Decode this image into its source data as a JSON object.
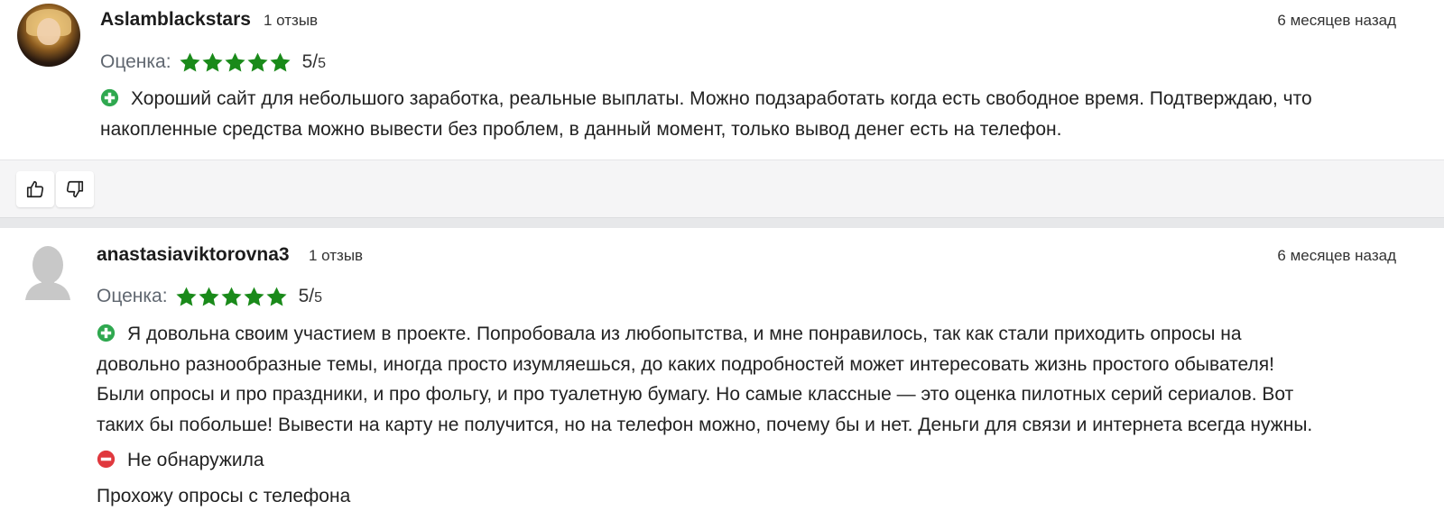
{
  "reviews": [
    {
      "username": "Aslamblackstars",
      "review_count": "1 отзыв",
      "date": "6 месяцев назад",
      "rating_label": "Оценка:",
      "rating_value": 5,
      "rating_max": 5,
      "score_num": "5/",
      "score_den": "5",
      "pros_icon": "plus-circle-icon",
      "pros_line1": "Хороший сайт для небольшого заработка, реальные выплаты. Можно подзаработать когда есть свободное время. Подтверждаю, что",
      "pros_line2": "накопленные средства можно вывести без проблем, в данный момент, только вывод денег есть на телефон."
    },
    {
      "username": "anastasiaviktorovna3",
      "review_count": "1 отзыв",
      "date": "6 месяцев назад",
      "rating_label": "Оценка:",
      "rating_value": 5,
      "rating_max": 5,
      "score_num": "5/",
      "score_den": "5",
      "pros_icon": "plus-circle-icon",
      "pros_line1": "Я довольна своим участием в проекте. Попробовала из любопытства, и мне понравилось, так как стали приходить опросы на",
      "pros_line2": "довольно разнообразные темы, иногда просто изумляешься, до каких подробностей может интересовать жизнь простого обывателя!",
      "pros_line3": "Были опросы и про праздники, и про фольгу, и про туалетную бумагу. Но самые классные — это оценка пилотных серий сериалов. Вот",
      "pros_line4": "таких бы побольше! Вывести на карту не получится, но на телефон можно, почему бы и нет. Деньги для связи и интернета всегда нужны.",
      "cons_icon": "minus-circle-icon",
      "cons": "Не обнаружила",
      "comment": "Прохожу опросы с телефона"
    }
  ],
  "votes": {
    "like_icon": "thumbs-up-icon",
    "dislike_icon": "thumbs-down-icon"
  },
  "colors": {
    "star": "#1a8a1a",
    "pros_icon": "#2fa84f",
    "cons_icon": "#e0393e",
    "vote_bar_bg": "#f5f5f6"
  }
}
